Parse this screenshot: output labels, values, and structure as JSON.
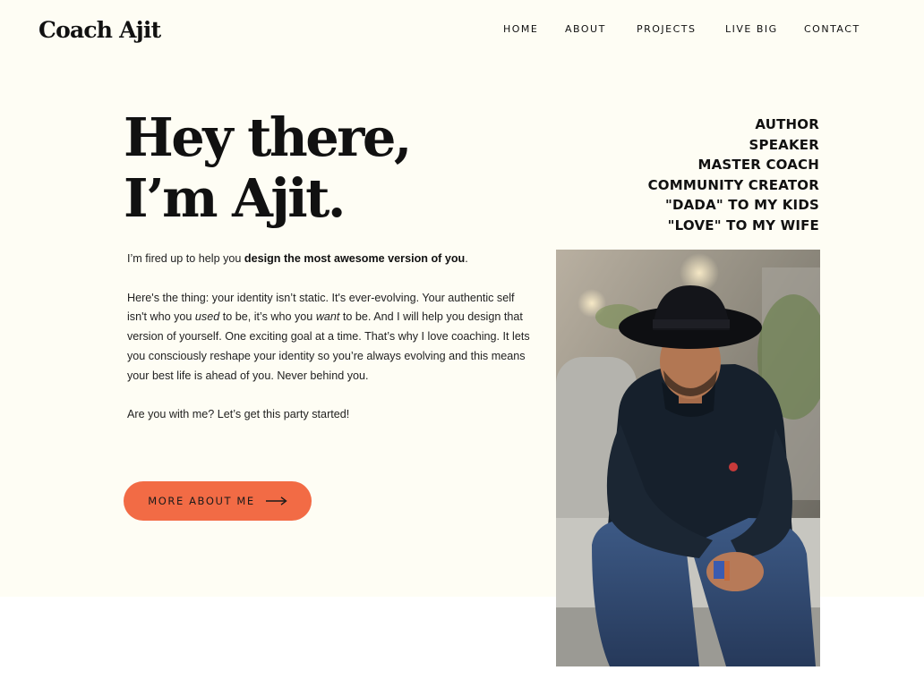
{
  "site": {
    "logo": "Coach Ajit"
  },
  "nav": {
    "items": [
      {
        "label": "HOME"
      },
      {
        "label": "ABOUT"
      },
      {
        "label": "PROJECTS"
      },
      {
        "label": "LIVE BIG"
      },
      {
        "label": "CONTACT"
      }
    ]
  },
  "hero": {
    "headline_line1": "Hey there,",
    "headline_line2": "I’m Ajit.",
    "roles": [
      "AUTHOR",
      "SPEAKER",
      "MASTER COACH",
      "COMMUNITY CREATOR",
      "\"DADA\" TO MY KIDS",
      "\"LOVE\" TO MY WIFE"
    ],
    "intro": {
      "prefix": "I’m fired up to help you ",
      "bold": "design the most awesome version of you",
      "suffix": "."
    },
    "paragraph2": {
      "part1": "Here's the thing: your identity isn’t static. It's ever-evolving. Your authentic self isn't who you ",
      "italic1": "used",
      "part2": " to be, it’s who you ",
      "italic2": "want",
      "part3": " to be. And I will help you design that version of yourself. One exciting goal at a time. That’s why I love coaching. It lets you consciously reshape your identity so you’re always evolving and this means your best life is ahead of you. Never behind you."
    },
    "paragraph3": "Are you with me? Let’s get this party started!",
    "cta_label": "MORE ABOUT ME"
  },
  "colors": {
    "hero_background": "#fefdf4",
    "accent": "#f26b45",
    "text": "#111111"
  },
  "icons": {
    "cta_arrow": "arrow-right-icon"
  }
}
